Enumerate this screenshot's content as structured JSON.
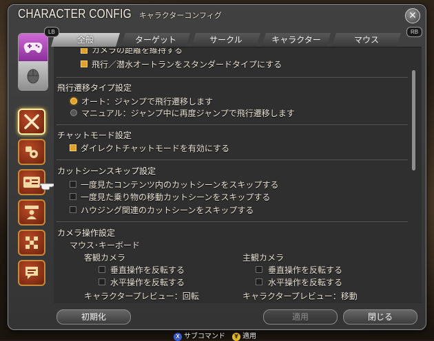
{
  "window": {
    "title": "CHARACTER CONFIG",
    "subtitle": "キャラクターコンフィグ"
  },
  "tabbar": {
    "lb": "LB",
    "rb": "RB",
    "tabs": [
      {
        "label": "全般",
        "active": true
      },
      {
        "label": "ターゲット",
        "active": false
      },
      {
        "label": "サークル",
        "active": false
      },
      {
        "label": "キャラクター",
        "active": false
      },
      {
        "label": "マウス",
        "active": false
      }
    ]
  },
  "rail": {
    "mode_icons": [
      "gamepad-icon",
      "mouse-icon"
    ],
    "category_icons": [
      "crossed-swords-icon",
      "gear-bag-icon",
      "id-card-icon",
      "character-portrait-icon",
      "checker-icon",
      "chat-bubble-icon"
    ]
  },
  "content": {
    "clipped_item": {
      "label": "カメラの距離を維持する",
      "checked": true
    },
    "item_flight_standard": {
      "label": "飛行／潜水オートランをスタンダードタイプにする",
      "checked": true
    },
    "flight_section": {
      "title": "飛行遷移タイプ設定",
      "options": [
        {
          "label": "オート：ジャンプで飛行遷移します",
          "selected": true
        },
        {
          "label": "マニュアル：ジャンプ中に再度ジャンプで飛行遷移します",
          "selected": false
        }
      ]
    },
    "chat_section": {
      "title": "チャットモード設定",
      "items": [
        {
          "label": "ダイレクトチャットモードを有効にする",
          "checked": true
        }
      ]
    },
    "cutscene_section": {
      "title": "カットシーンスキップ設定",
      "items": [
        {
          "label": "一度見たコンテンツ内のカットシーンをスキップする",
          "checked": false
        },
        {
          "label": "一度見た乗り物の移動カットシーンをスキップする",
          "checked": false
        },
        {
          "label": "ハウジング関連のカットシーンをスキップする",
          "checked": false
        }
      ]
    },
    "camera_section": {
      "title": "カメラ操作設定",
      "subtitle": "マウス･キーボード",
      "objective": {
        "label": "客観カメラ",
        "items": [
          {
            "label": "垂直操作を反転する",
            "checked": false
          },
          {
            "label": "水平操作を反転する",
            "checked": false
          }
        ],
        "preview": "キャラクタープレビュー：回転"
      },
      "subjective": {
        "label": "主観カメラ",
        "items": [
          {
            "label": "垂直操作を反転する",
            "checked": false
          },
          {
            "label": "水平操作を反転する",
            "checked": false
          }
        ],
        "preview": "キャラクタープレビュー：移動"
      }
    }
  },
  "footer": {
    "reset": "初期化",
    "apply": "適用",
    "close": "閉じる"
  },
  "hints": {
    "x_glyph": "X",
    "x_label": "サブコマンド",
    "y_glyph": "Y",
    "y_label": "適用"
  }
}
